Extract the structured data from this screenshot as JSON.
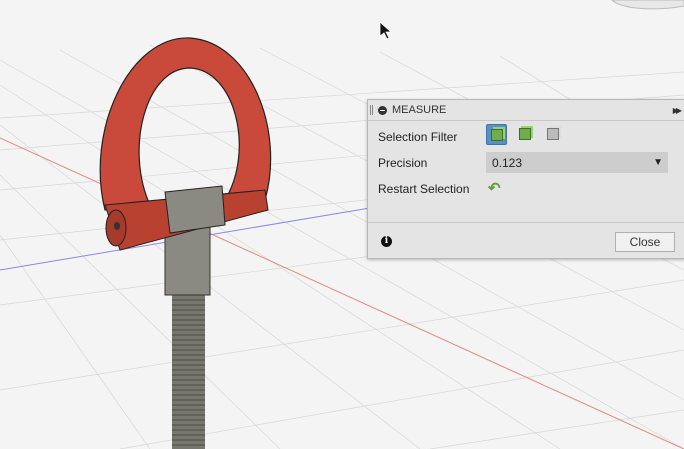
{
  "measure_panel": {
    "title": "MEASURE",
    "selection_filter_label": "Selection Filter",
    "selection_filter_icons": [
      "select-body-icon",
      "select-face-icon",
      "select-component-icon"
    ],
    "selected_filter_index": 0,
    "precision_label": "Precision",
    "precision_value": "0.123",
    "restart_label": "Restart Selection",
    "close_label": "Close",
    "info_symbol": "i"
  },
  "colors": {
    "part_red": "#c94a3a",
    "steel": "#8a8a82",
    "accent_blue": "#5a8fc2",
    "icon_green": "#6fae4a"
  }
}
